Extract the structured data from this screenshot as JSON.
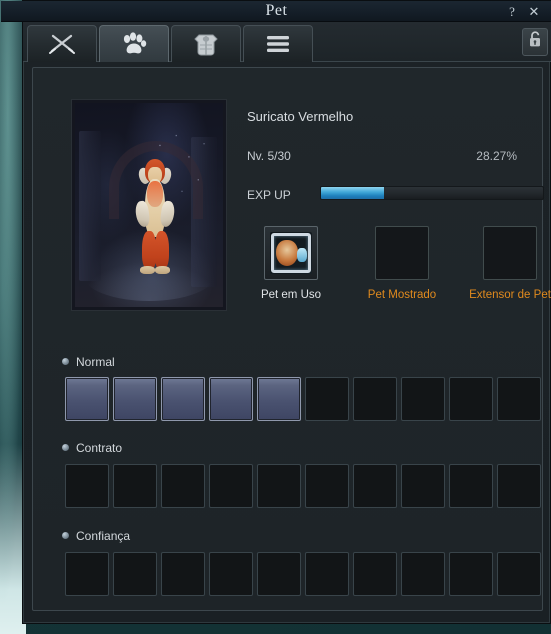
{
  "window": {
    "title": "Pet",
    "help_label": "?",
    "close_label": "✕"
  },
  "tabs": [
    {
      "id": "combat",
      "icon": "crossed-swords-icon",
      "active": false
    },
    {
      "id": "pet",
      "icon": "paw-print-icon",
      "active": true
    },
    {
      "id": "gear",
      "icon": "armor-chestplate-icon",
      "active": false
    },
    {
      "id": "menu",
      "icon": "hamburger-menu-icon",
      "active": false
    }
  ],
  "lock": {
    "icon": "unlocked-padlock-icon"
  },
  "pet": {
    "name": "Suricato Vermelho",
    "level": "Nv.  5/30",
    "exp_percent": "28.27%",
    "exp_value": 28.27,
    "exp_label": "EXP UP"
  },
  "equipment": [
    {
      "id": "pet-em-uso",
      "label": "Pet em Uso",
      "filled": true,
      "label_color": "#dfe3e6"
    },
    {
      "id": "pet-mostrado",
      "label": "Pet Mostrado",
      "filled": false,
      "label_color": "#e08a1e"
    },
    {
      "id": "extensor-de-pet",
      "label": "Extensor de Pet",
      "filled": false,
      "label_color": "#e08a1e"
    }
  ],
  "sections": [
    {
      "id": "normal",
      "label": "Normal",
      "slot_count": 10,
      "unlocked_count": 5
    },
    {
      "id": "contrato",
      "label": "Contrato",
      "slot_count": 10,
      "unlocked_count": 0
    },
    {
      "id": "confianca",
      "label": "Confiança",
      "slot_count": 10,
      "unlocked_count": 0
    }
  ],
  "colors": {
    "accent_orange": "#e08a1e",
    "exp_bar_blue": "#42a8d8",
    "panel_bg": "#20272b",
    "slot_unlocked": "#5b6480"
  }
}
